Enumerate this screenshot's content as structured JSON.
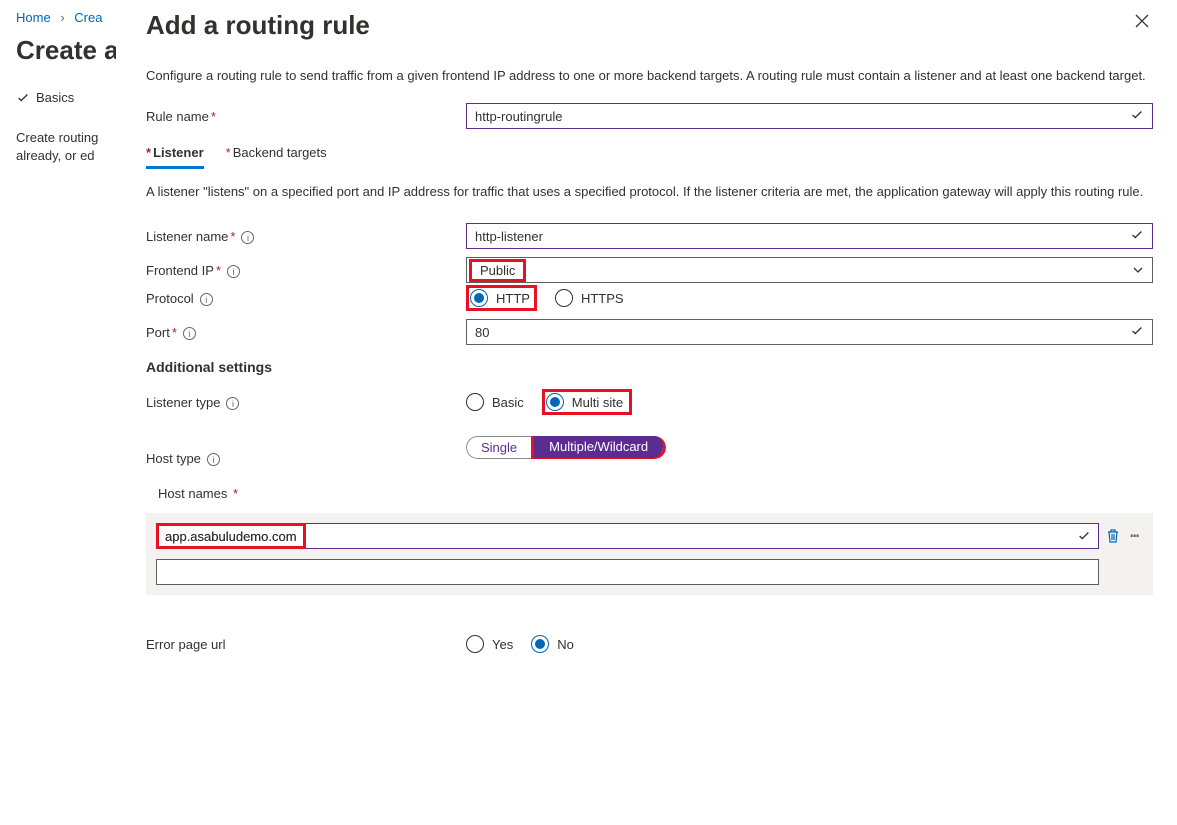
{
  "breadcrumb": {
    "home": "Home",
    "next": "Crea"
  },
  "bg": {
    "heading": "Create a",
    "tab_basics": "Basics",
    "desc_line1": "Create routing",
    "desc_line2": "already, or ed"
  },
  "panel": {
    "title": "Add a routing rule",
    "desc": "Configure a routing rule to send traffic from a given frontend IP address to one or more backend targets. A routing rule must contain a listener and at least one backend target.",
    "rule_name_label": "Rule name",
    "rule_name_value": "http-routingrule",
    "tabs": {
      "listener": "Listener",
      "backend": "Backend targets"
    },
    "listener_desc": "A listener \"listens\" on a specified port and IP address for traffic that uses a specified protocol. If the listener criteria are met, the application gateway will apply this routing rule.",
    "listener_name_label": "Listener name",
    "listener_name_value": "http-listener",
    "frontend_ip_label": "Frontend IP",
    "frontend_ip_value": "Public",
    "protocol_label": "Protocol",
    "protocol_http": "HTTP",
    "protocol_https": "HTTPS",
    "port_label": "Port",
    "port_value": "80",
    "additional_settings": "Additional settings",
    "listener_type_label": "Listener type",
    "listener_type_basic": "Basic",
    "listener_type_multi": "Multi site",
    "host_type_label": "Host type",
    "host_type_single": "Single",
    "host_type_multi": "Multiple/Wildcard",
    "host_names_label": "Host names",
    "host_names_value": "app.asabuludemo.com",
    "error_page_label": "Error page url",
    "error_yes": "Yes",
    "error_no": "No"
  }
}
